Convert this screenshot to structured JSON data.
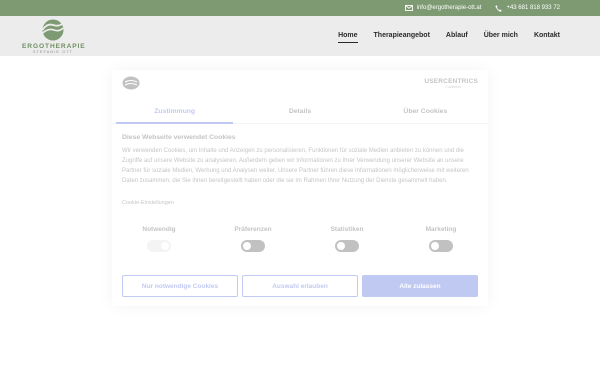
{
  "topbar": {
    "email": "info@ergotherapie-ott.at",
    "phone": "+43 681 818 933 72",
    "email_icon": "envelope-icon",
    "phone_icon": "phone-icon"
  },
  "logo": {
    "name": "ERGOTHERAPIE",
    "subtitle": "STEFANIE OTT"
  },
  "nav": {
    "items": [
      {
        "label": "Home",
        "active": true
      },
      {
        "label": "Therapieangebot",
        "active": false
      },
      {
        "label": "Ablauf",
        "active": false
      },
      {
        "label": "Über mich",
        "active": false
      },
      {
        "label": "Kontakt",
        "active": false
      }
    ]
  },
  "consent": {
    "brand": "USERCENTRICS",
    "brand_sub": "Cookiebot",
    "tabs": [
      "Zustimmung",
      "Details",
      "Über Cookies"
    ],
    "title": "Diese Webseite verwendet Cookies",
    "text": "Wir verwenden Cookies, um Inhalte und Anzeigen zu personalisieren, Funktionen für soziale Medien anbieten zu können und die Zugriffe auf unsere Website zu analysieren. Außerdem geben wir Informationen zu Ihrer Verwendung unserer Website an unsere Partner für soziale Medien, Werbung und Analysen weiter. Unsere Partner führen diese Informationen möglicherweise mit weiteren Daten zusammen, die Sie ihnen bereitgestellt haben oder die sie im Rahmen Ihrer Nutzung der Dienste gesammelt haben.",
    "link": "Cookie-Einstellungen",
    "categories": [
      {
        "label": "Notwendig",
        "state": "disabled"
      },
      {
        "label": "Präferenzen",
        "state": "off"
      },
      {
        "label": "Statistiken",
        "state": "off"
      },
      {
        "label": "Marketing",
        "state": "off"
      }
    ],
    "buttons": {
      "necessary": "Nur notwendige Cookies",
      "selection": "Auswahl erlauben",
      "all": "Alle zulassen"
    }
  },
  "colors": {
    "topbar": "#7d9a72",
    "brand_green": "#6f8f63",
    "accent_blue": "#1032cf"
  }
}
